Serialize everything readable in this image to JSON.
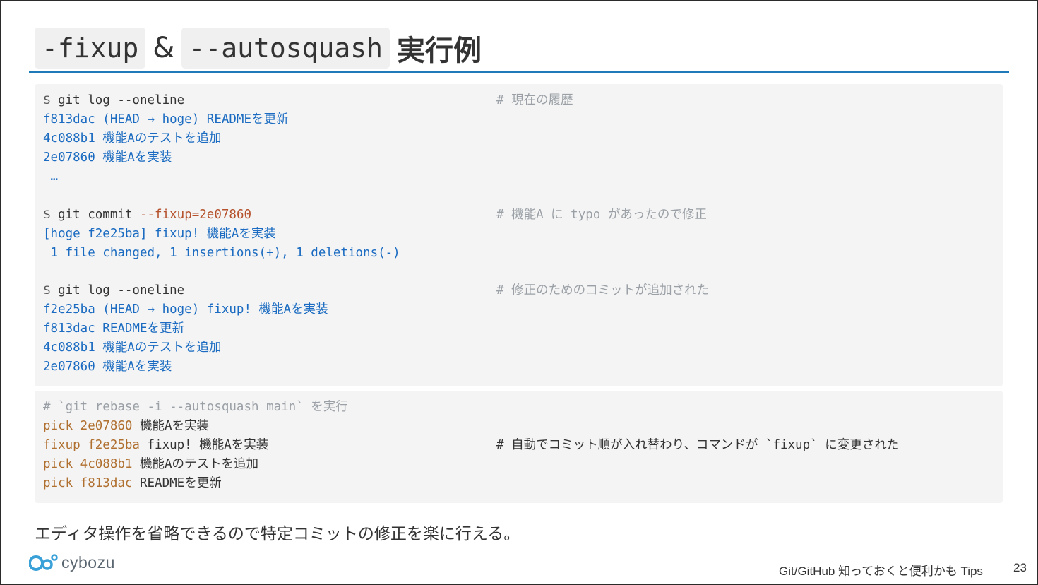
{
  "title": {
    "chip1": "-fixup",
    "amp": "&",
    "chip2": "--autosquash",
    "rest": "実行例"
  },
  "block1": {
    "lines": [
      {
        "prompt": "$ ",
        "text": "git log --oneline",
        "comment": "# 現在の履歴"
      },
      {
        "text": "f813dac (HEAD → hoge) READMEを更新"
      },
      {
        "text": "4c088b1 機能Aのテストを追加"
      },
      {
        "text": "2e07860 機能Aを実装"
      },
      {
        "text": " …"
      },
      {
        "prompt": "$ ",
        "text": "git commit ",
        "flag": "--fixup=2e07860",
        "comment": "# 機能A に typo があったので修正"
      },
      {
        "text": "[hoge f2e25ba] fixup! 機能Aを実装"
      },
      {
        "text": " 1 file changed, 1 insertions(+), 1 deletions(-)"
      },
      {
        "prompt": "$ ",
        "text": "git log --oneline",
        "comment": "# 修正のためのコミットが追加された"
      },
      {
        "text": "f2e25ba (HEAD → hoge) fixup! 機能Aを実装"
      },
      {
        "text": "f813dac READMEを更新"
      },
      {
        "text": "4c088b1 機能Aのテストを追加"
      },
      {
        "text": "2e07860 機能Aを実装"
      }
    ]
  },
  "block2": {
    "header": "# `git rebase -i --autosquash main` を実行",
    "lines": [
      {
        "cmd": "pick 2e07860",
        "msg": " 機能Aを実装"
      },
      {
        "cmd": "fixup f2e25ba",
        "msg": " fixup! 機能Aを実装",
        "comment": "# 自動でコミット順が入れ替わり、コマンドが `fixup` に変更された"
      },
      {
        "cmd": "pick 4c088b1",
        "msg": " 機能Aのテストを追加"
      },
      {
        "cmd": "pick f813dac",
        "msg": " READMEを更新"
      }
    ]
  },
  "caption": "エディタ操作を省略できるので特定コミットの修正を楽に行える。",
  "logo": "cybozu",
  "footer": {
    "title": "Git/GitHub 知っておくと便利かも Tips",
    "page": "23"
  },
  "colors": {
    "accent_rule": "#1f7ab8",
    "code_blue": "#1a6bc1",
    "comment_gray": "#9aa0a6",
    "keyword_orange": "#b07030"
  }
}
